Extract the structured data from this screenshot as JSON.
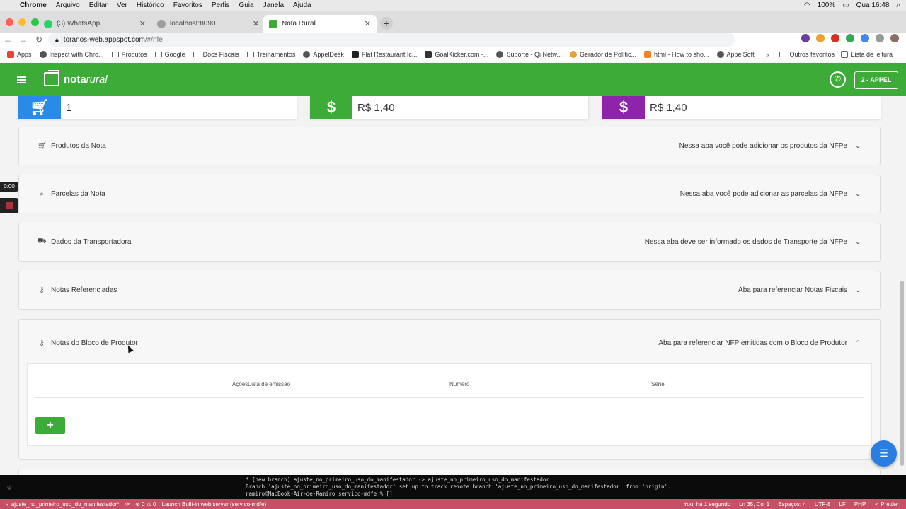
{
  "menubar": {
    "app": "Chrome",
    "items": [
      "Arquivo",
      "Editar",
      "Ver",
      "Histórico",
      "Favoritos",
      "Perfis",
      "Guia",
      "Janela",
      "Ajuda"
    ],
    "battery": "100%",
    "clock": "Qua 16:48"
  },
  "browser": {
    "tabs": [
      {
        "label": "(3) WhatsApp",
        "color": "#25d366"
      },
      {
        "label": "localhost:8090",
        "color": "#9e9e9e"
      },
      {
        "label": "Nota Rural",
        "color": "#3dab37"
      }
    ],
    "url_host": "toranos-web.appspot.com",
    "url_path": "/#/nfe",
    "bookmarks": [
      {
        "label": "Apps"
      },
      {
        "label": "Inspect with Chro..."
      },
      {
        "label": "Produtos"
      },
      {
        "label": "Google"
      },
      {
        "label": "Docs Fiscais"
      },
      {
        "label": "Treinamentos"
      },
      {
        "label": "AppelDesk"
      },
      {
        "label": "Flat Restaurant Ic..."
      },
      {
        "label": "GoalKicker.com -..."
      },
      {
        "label": "Suporte - Qi Netw..."
      },
      {
        "label": "Gerador de Polític..."
      },
      {
        "label": "html - How to sho..."
      },
      {
        "label": "AppelSoft"
      }
    ],
    "bookmarks_more": "»",
    "other_favorites": "Outros favoritos",
    "reading_list": "Lista de leitura"
  },
  "app": {
    "logo_bold": "nota",
    "logo_italic": "rural",
    "user_button": "2 - APPEL"
  },
  "stats": [
    {
      "value": "1",
      "color": "#2b8ae8",
      "icon": "cart-icon"
    },
    {
      "value": "R$ 1,40",
      "color": "#3dab37",
      "icon": "dollar-icon"
    },
    {
      "value": "R$ 1,40",
      "color": "#8e24aa",
      "icon": "dollar-icon"
    }
  ],
  "panels": [
    {
      "title": "Produtos da Nota",
      "desc": "Nessa aba você pode adicionar os produtos da NFPe",
      "icon": "cart-icon"
    },
    {
      "title": "Parcelas da Nota",
      "desc": "Nessa aba você pode adicionar as parcelas da NFPe",
      "icon": "search-icon"
    },
    {
      "title": "Dados da Transportadora",
      "desc": "Nessa aba deve ser informado os dados de Transporte da NFPe",
      "icon": "truck-icon"
    },
    {
      "title": "Notas Referenciadas",
      "desc": "Aba para referenciar Notas Fiscais",
      "icon": "key-icon"
    },
    {
      "title": "Notas do Bloco de Produtor",
      "desc": "Aba para referenciar NFP emitidas com o Bloco de Produtor",
      "icon": "key-icon"
    }
  ],
  "table": {
    "col_acoes": "Ações",
    "col_data": "Data de emissão",
    "col_numero": "Número",
    "col_serie": "Série"
  },
  "add_button": "+",
  "recorder_time": "0:00",
  "terminal": {
    "line1": "* [new branch]      ajuste_no_primeiro_uso_do_manifestador -> ajuste_no_primeiro_uso_do_manifestador",
    "line2": "Branch 'ajuste_no_primeiro_uso_do_manifestador' set up to track remote branch 'ajuste_no_primeiro_uso_do_manifestador' from 'origin'.",
    "line3": "ramiro@MacBook-Air-de-Ramiro servico-mdfe % []"
  },
  "statusbar": {
    "branch": "ajuste_no_primeiro_uso_do_manifestador*",
    "problems": "⊗ 0 ⚠ 0",
    "server": "Launch Built-in web server (servico-mdfe)",
    "blame": "You, há 1 segundo",
    "position": "Ln 35, Col 1",
    "spaces": "Espaços: 4",
    "encoding": "UTF-8",
    "eol": "LF",
    "language": "PHP",
    "prettier": "✓ Prettier"
  }
}
